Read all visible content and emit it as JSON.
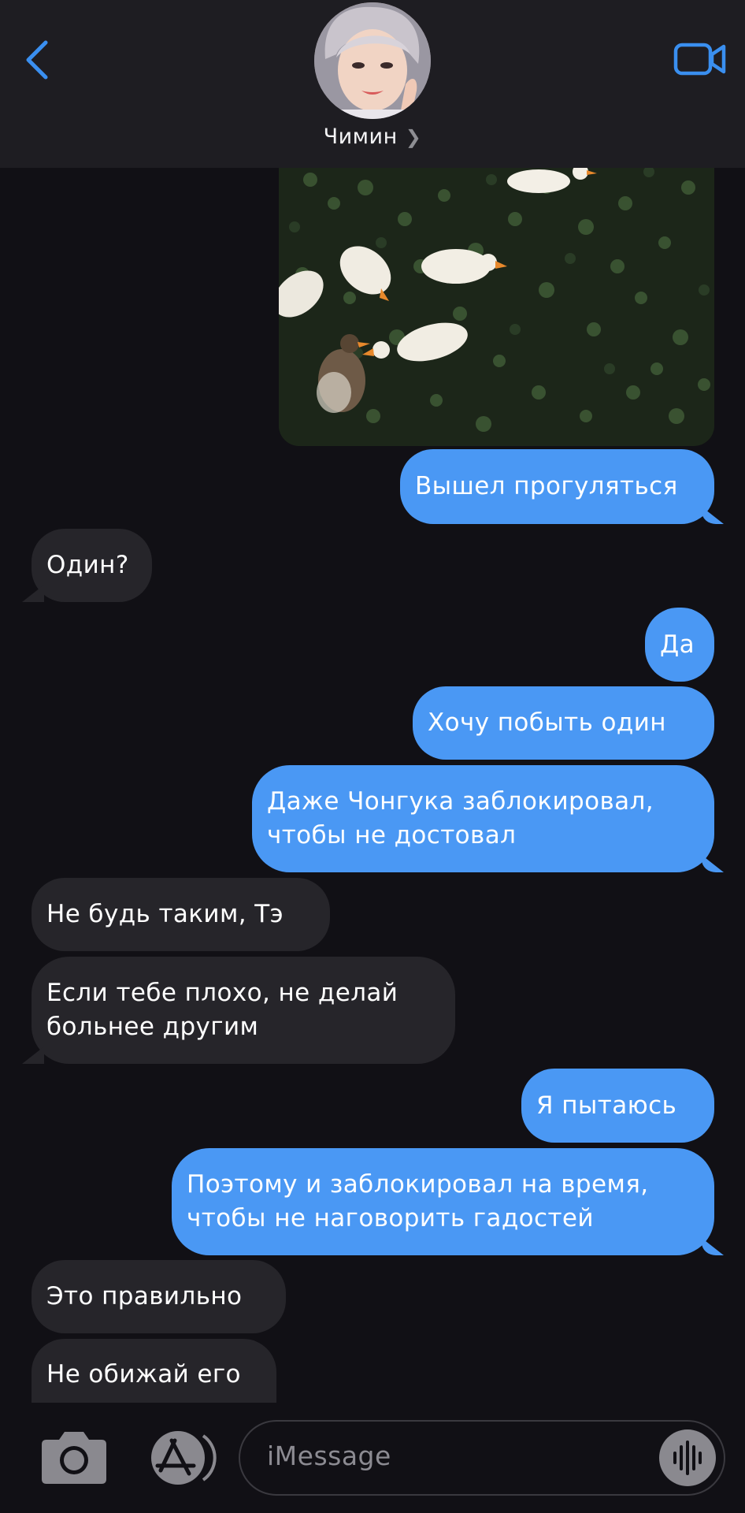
{
  "header": {
    "contact_name": "Чимин",
    "back_icon": "chevron-left-icon",
    "video_icon": "video-camera-icon",
    "accent_color": "#3a8ff0"
  },
  "messages": [
    {
      "id": 1,
      "direction": "outgoing",
      "text": "Вышел прогуляться"
    },
    {
      "id": 2,
      "direction": "incoming",
      "text": "Один?"
    },
    {
      "id": 3,
      "direction": "outgoing",
      "text": "Да"
    },
    {
      "id": 4,
      "direction": "outgoing",
      "text": "Хочу побыть один"
    },
    {
      "id": 5,
      "direction": "outgoing",
      "lines": [
        "Даже Чонгука заблокировал,",
        "чтобы не достовал"
      ]
    },
    {
      "id": 6,
      "direction": "incoming",
      "text": "Не будь таким, Тэ"
    },
    {
      "id": 7,
      "direction": "incoming",
      "lines": [
        "Если тебе плохо, не  делай",
        "больнее другим"
      ]
    },
    {
      "id": 8,
      "direction": "outgoing",
      "text": "Я пытаюсь"
    },
    {
      "id": 9,
      "direction": "outgoing",
      "lines": [
        "Поэтому и заблокировал на время,",
        "чтобы не наговорить гадостей"
      ]
    },
    {
      "id": 10,
      "direction": "incoming",
      "text": "Это правильно"
    },
    {
      "id": 11,
      "direction": "incoming",
      "text": "Не обижай его"
    }
  ],
  "photo_icon": "duck-pond-photo",
  "input_bar": {
    "placeholder": "iMessage",
    "camera_icon": "camera-icon",
    "apps_icon": "app-store-icon",
    "audio_icon": "waveform-icon"
  },
  "colors": {
    "background": "#111015",
    "outgoing_bubble": "#4a98f4",
    "incoming_bubble": "#26252a"
  }
}
